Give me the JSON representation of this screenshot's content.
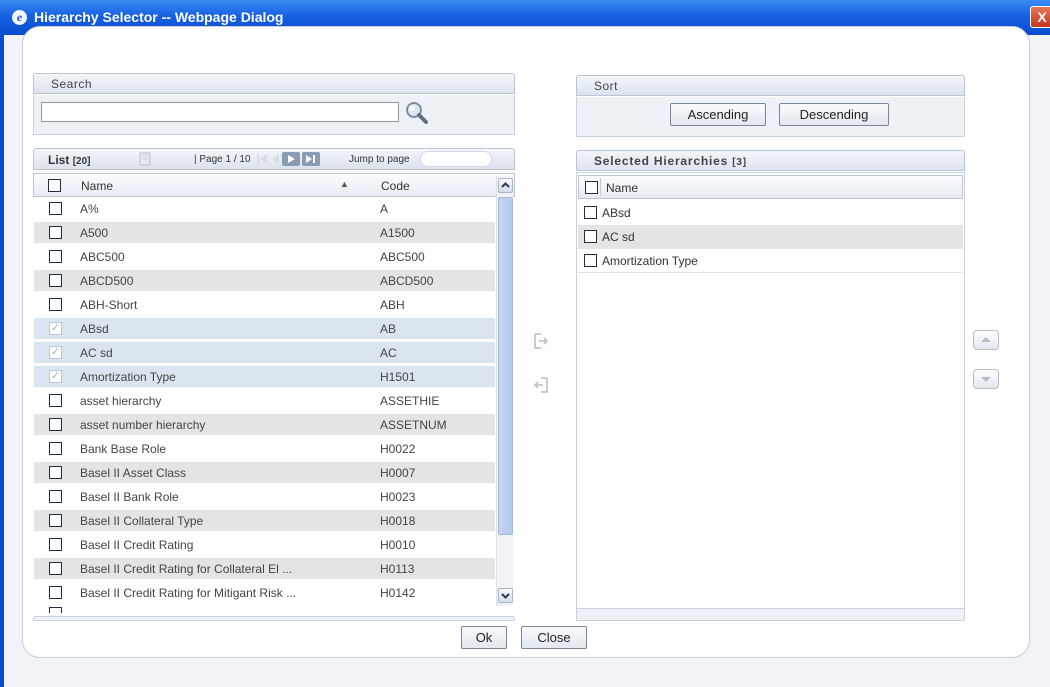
{
  "window": {
    "title": "Hierarchy Selector -- Webpage Dialog",
    "close_glyph": "X"
  },
  "search": {
    "header": "Search",
    "value": "",
    "placeholder": ""
  },
  "sort": {
    "header": "Sort",
    "ascending_label": "Ascending",
    "descending_label": "Descending"
  },
  "list": {
    "label": "List",
    "count": "[20]",
    "page_text": "| Page 1 / 10",
    "jump_label": "Jump to page",
    "jump_value": "",
    "columns": {
      "name": "Name",
      "code": "Code"
    },
    "rows": [
      {
        "name": "A%",
        "code": "A",
        "checked": false
      },
      {
        "name": "A500",
        "code": "A1500",
        "checked": false
      },
      {
        "name": "ABC500",
        "code": "ABC500",
        "checked": false
      },
      {
        "name": "ABCD500",
        "code": "ABCD500",
        "checked": false
      },
      {
        "name": "ABH-Short",
        "code": "ABH",
        "checked": false
      },
      {
        "name": "ABsd",
        "code": "AB",
        "checked": true
      },
      {
        "name": "AC sd",
        "code": "AC",
        "checked": true
      },
      {
        "name": "Amortization Type",
        "code": "H1501",
        "checked": true
      },
      {
        "name": "asset hierarchy",
        "code": "ASSETHIE",
        "checked": false
      },
      {
        "name": "asset number hierarchy",
        "code": "ASSETNUM",
        "checked": false
      },
      {
        "name": "Bank Base Role",
        "code": "H0022",
        "checked": false
      },
      {
        "name": "Basel II Asset Class",
        "code": "H0007",
        "checked": false
      },
      {
        "name": "Basel II Bank Role",
        "code": "H0023",
        "checked": false
      },
      {
        "name": "Basel II Collateral Type",
        "code": "H0018",
        "checked": false
      },
      {
        "name": "Basel II Credit Rating",
        "code": "H0010",
        "checked": false
      },
      {
        "name": "Basel II Credit Rating for Collateral El ...",
        "code": "H0113",
        "checked": false
      },
      {
        "name": "Basel II Credit Rating for Mitigant Risk ...",
        "code": "H0142",
        "checked": false
      }
    ]
  },
  "selected": {
    "header": "Selected Hierarchies",
    "count": "[3]",
    "column_name": "Name",
    "items": [
      {
        "name": "ABsd"
      },
      {
        "name": "AC sd"
      },
      {
        "name": "Amortization Type"
      }
    ]
  },
  "footer": {
    "ok_label": "Ok",
    "close_label": "Close"
  },
  "icons": {
    "search": "magnifier-icon",
    "move_right": "move-right-icon",
    "move_left": "move-left-icon",
    "move_up": "move-up-icon",
    "move_down": "move-down-icon"
  },
  "colors": {
    "titlebar": "#1760e2",
    "selected_row": "#dbe5ef",
    "alt_row": "#e4e4e4"
  }
}
